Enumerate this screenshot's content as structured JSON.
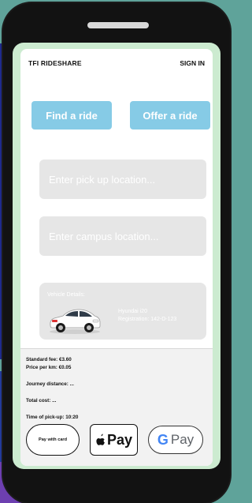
{
  "header": {
    "brand": "TFI RIDESHARE",
    "sign_in": "SIGN IN"
  },
  "actions": {
    "find": "Find a ride",
    "offer": "Offer a ride"
  },
  "inputs": {
    "pickup_placeholder": "Enter pick up location...",
    "campus_placeholder": "Enter campus location..."
  },
  "vehicle": {
    "title": "Vehicle Details:",
    "model": "Hyundai i20",
    "registration": "Registration: 142-D-123"
  },
  "fare": {
    "standard_fee": "Standard fee: €3.60",
    "price_per_km": "Price per km: €0.05",
    "journey_distance": "Journey distance: ...",
    "total_cost": "Total cost: ...",
    "pickup_time": "Time of pick-up: 10:20"
  },
  "payment": {
    "card_label": "Pay with card",
    "apple_label": "Pay",
    "google_label": "Pay",
    "google_letter": "G"
  },
  "colors": {
    "accent_blue": "#86cbe6",
    "field_grey": "#e6e6e6",
    "screen_green": "#ccebd0",
    "phone_body": "#121212"
  }
}
